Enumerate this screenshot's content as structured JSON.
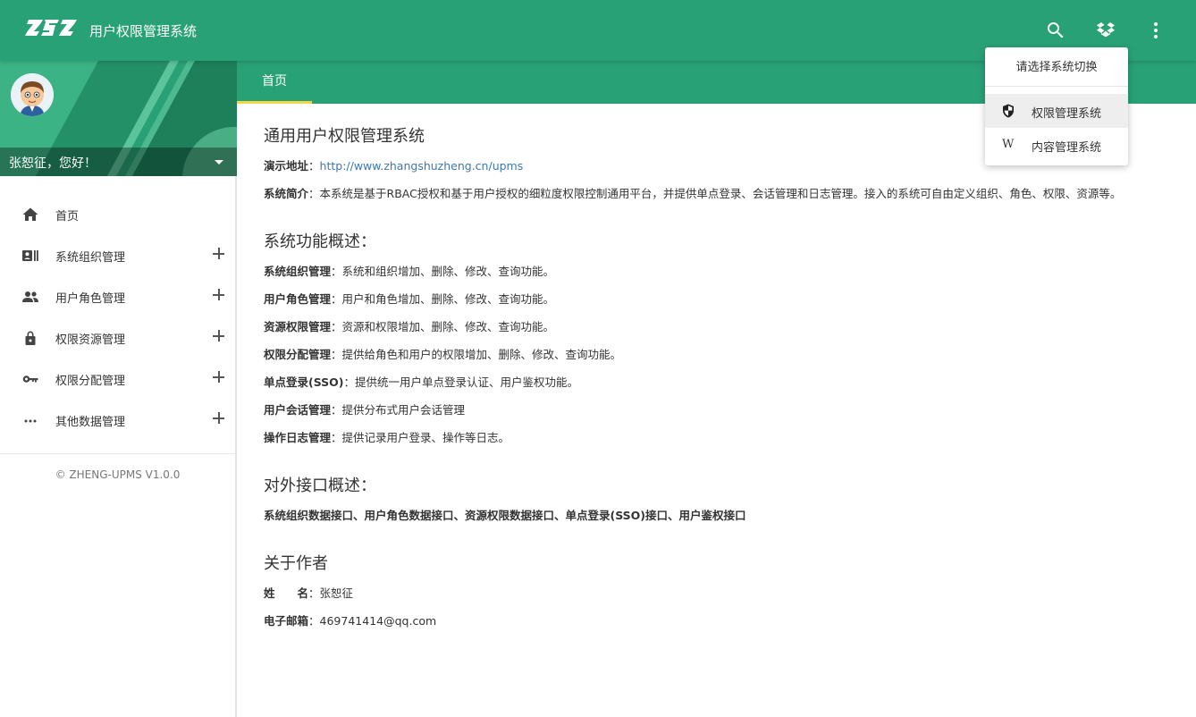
{
  "header": {
    "logo_text": "ZSZ",
    "title": "用户权限管理系统",
    "icons": [
      "search-icon",
      "dropbox-icon",
      "more-vert-icon"
    ],
    "color": "#29a176"
  },
  "tabs": [
    {
      "label": "首页",
      "active": true
    }
  ],
  "sidebar": {
    "greeting": "张恕征，您好！",
    "menu": [
      {
        "label": "首页",
        "icon": "home-icon",
        "expandable": false
      },
      {
        "label": "系统组织管理",
        "icon": "org-card-icon",
        "expandable": true
      },
      {
        "label": "用户角色管理",
        "icon": "people-icon",
        "expandable": true
      },
      {
        "label": "权限资源管理",
        "icon": "lock-icon",
        "expandable": true
      },
      {
        "label": "权限分配管理",
        "icon": "key-icon",
        "expandable": true
      },
      {
        "label": "其他数据管理",
        "icon": "more-horiz-icon",
        "expandable": true
      }
    ],
    "copyright": "© ZHENG-UPMS V1.0.0"
  },
  "dropdown": {
    "header": "请选择系统切换",
    "items": [
      {
        "label": "权限管理系统",
        "icon": "shield-icon",
        "active": true
      },
      {
        "label": "内容管理系统",
        "icon": "wikipedia-icon",
        "icon_glyph": "W",
        "active": false
      }
    ]
  },
  "content": {
    "title": "通用用户权限管理系统",
    "demo": {
      "label": "演示地址",
      "value": "http://www.zhangshuzheng.cn/upms"
    },
    "intro": {
      "label": "系统简介",
      "value": "本系统是基于RBAC授权和基于用户授权的细粒度权限控制通用平台，并提供单点登录、会话管理和日志管理。接入的系统可自由定义组织、角色、权限、资源等。"
    },
    "features_title": "系统功能概述：",
    "features": [
      {
        "label": "系统组织管理",
        "value": "系统和组织增加、删除、修改、查询功能。"
      },
      {
        "label": "用户角色管理",
        "value": "用户和角色增加、删除、修改、查询功能。"
      },
      {
        "label": "资源权限管理",
        "value": "资源和权限增加、删除、修改、查询功能。"
      },
      {
        "label": "权限分配管理",
        "value": "提供给角色和用户的权限增加、删除、修改、查询功能。"
      },
      {
        "label": "单点登录(SSO)",
        "value": "提供统一用户单点登录认证、用户鉴权功能。"
      },
      {
        "label": "用户会话管理",
        "value": "提供分布式用户会话管理"
      },
      {
        "label": "操作日志管理",
        "value": "提供记录用户登录、操作等日志。"
      }
    ],
    "api_title": "对外接口概述：",
    "api_list": "系统组织数据接口、用户角色数据接口、资源权限数据接口、单点登录(SSO)接口、用户鉴权接口",
    "author_title": "关于作者",
    "author": [
      {
        "label": "姓　　名",
        "value": "张恕征"
      },
      {
        "label": "电子邮箱",
        "value": "469741414@qq.com"
      }
    ]
  },
  "separator": "："
}
